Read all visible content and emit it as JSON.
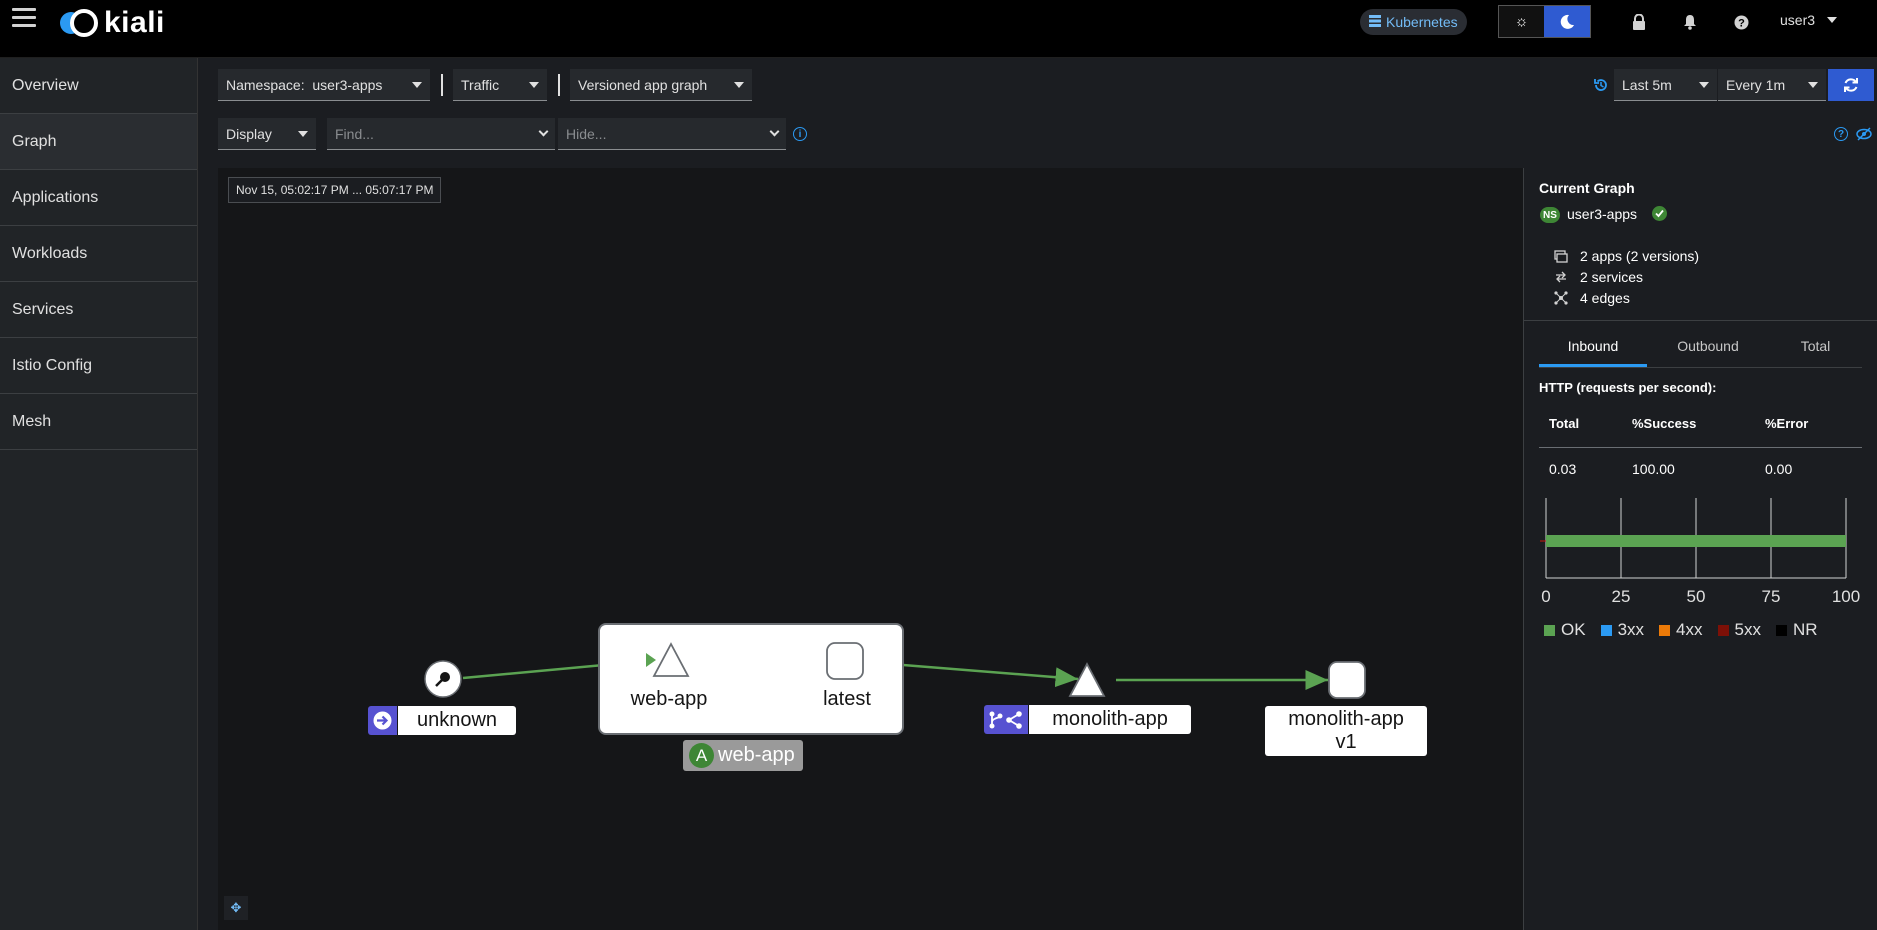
{
  "app": {
    "name": "kiali"
  },
  "header": {
    "cluster_label": "Kubernetes",
    "user": "user3",
    "icons": [
      "menu-icon",
      "lock-icon",
      "bell-icon",
      "help-icon"
    ]
  },
  "sidebar": {
    "items": [
      {
        "label": "Overview",
        "active": false
      },
      {
        "label": "Graph",
        "active": true
      },
      {
        "label": "Applications",
        "active": false
      },
      {
        "label": "Workloads",
        "active": false
      },
      {
        "label": "Services",
        "active": false
      },
      {
        "label": "Istio Config",
        "active": false
      },
      {
        "label": "Mesh",
        "active": false
      }
    ]
  },
  "toolbar": {
    "namespace_label": "Namespace:",
    "namespace_value": "user3-apps",
    "traffic_label": "Traffic",
    "graph_type": "Versioned app graph",
    "display_label": "Display",
    "find_placeholder": "Find...",
    "hide_placeholder": "Hide...",
    "duration": "Last 5m",
    "refresh_interval": "Every 1m"
  },
  "graph": {
    "time_range": "Nov 15, 05:02:17 PM ... 05:07:17 PM",
    "nodes": {
      "unknown": "unknown",
      "webapp_service": "web-app",
      "latest": "latest",
      "app_box": "web-app",
      "app_badge": "A",
      "monolith": "monolith-app",
      "monolith_v1_line1": "monolith-app",
      "monolith_v1_line2": "v1"
    },
    "edge_color": "#5ba352"
  },
  "panel": {
    "title": "Current Graph",
    "ns_badge": "NS",
    "namespace": "user3-apps",
    "summary": {
      "apps": "2 apps (2 versions)",
      "services": "2 services",
      "edges": "4 edges"
    },
    "tabs": [
      "Inbound",
      "Outbound",
      "Total"
    ],
    "active_tab": "Inbound",
    "http_title": "HTTP (requests per second):",
    "table": {
      "headers": [
        "Total",
        "%Success",
        "%Error"
      ],
      "values": [
        "0.03",
        "100.00",
        "0.00"
      ]
    }
  },
  "chart_data": {
    "type": "bar",
    "orientation": "horizontal",
    "categories": [
      ""
    ],
    "series": [
      {
        "name": "OK",
        "values": [
          100
        ],
        "color": "#5ba352"
      },
      {
        "name": "3xx",
        "values": [
          0
        ],
        "color": "#2b9af3"
      },
      {
        "name": "4xx",
        "values": [
          0
        ],
        "color": "#ec7a08"
      },
      {
        "name": "5xx",
        "values": [
          0
        ],
        "color": "#7d1007"
      },
      {
        "name": "NR",
        "values": [
          0
        ],
        "color": "#000000"
      }
    ],
    "xlim": [
      0,
      100
    ],
    "xticks": [
      "0",
      "25",
      "50",
      "75",
      "100"
    ],
    "legend": "bottom",
    "grid": true
  }
}
